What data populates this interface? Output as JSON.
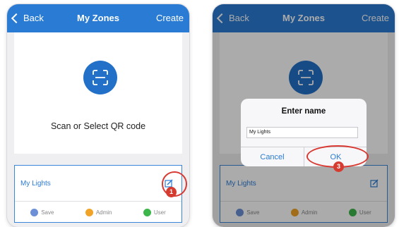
{
  "left_screen": {
    "nav": {
      "back": "Back",
      "title": "My Zones",
      "create": "Create"
    },
    "scan_text": "Scan or Select QR code",
    "zone": {
      "name": "My Lights"
    },
    "permissions": [
      {
        "label": "Save",
        "color": "#6c8fd6"
      },
      {
        "label": "Admin",
        "color": "#f0a326"
      },
      {
        "label": "User",
        "color": "#3cb54a"
      }
    ],
    "step_badge": "1"
  },
  "right_screen": {
    "nav": {
      "back": "Back",
      "title": "My Zones",
      "create": "Create"
    },
    "dialog": {
      "title": "Enter name",
      "input_value": "My Lights",
      "cancel": "Cancel",
      "ok": "OK"
    },
    "zone": {
      "name": "My Lights"
    },
    "permissions": [
      {
        "label": "Save",
        "color": "#6c8fd6"
      },
      {
        "label": "Admin",
        "color": "#f0a326"
      },
      {
        "label": "User",
        "color": "#3cb54a"
      }
    ],
    "step_badge": "3"
  },
  "colors": {
    "nav_blue": "#2a7bd3",
    "annotation_red": "#d83a33"
  },
  "icons": [
    "back-chevron-icon",
    "qr-scan-icon",
    "edit-icon",
    "save-icon",
    "admin-icon",
    "user-icon"
  ]
}
